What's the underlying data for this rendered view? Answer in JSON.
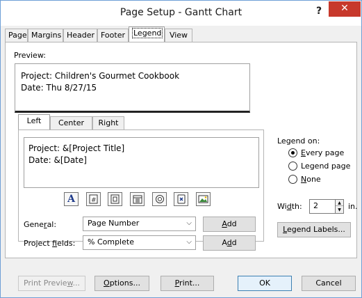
{
  "window": {
    "title": "Page Setup - Gantt Chart",
    "help": "?",
    "close": "✕"
  },
  "tabs": [
    "Page",
    "Margins",
    "Header",
    "Footer",
    "Legend",
    "View"
  ],
  "active_tab": "Legend",
  "preview": {
    "label": "Preview:",
    "lines": [
      "Project: Children's Gourmet Cookbook",
      "Date: Thu 8/27/15"
    ]
  },
  "alignment_tabs": [
    "Left",
    "Center",
    "Right"
  ],
  "active_alignment_tab": "Left",
  "legend_text": {
    "lines": [
      "Project: &[Project Title]",
      "Date: &[Date]"
    ]
  },
  "format_buttons": [
    {
      "name": "format-text-icon",
      "tooltip": "Format Text"
    },
    {
      "name": "insert-page-number-icon",
      "tooltip": "Insert Page Number"
    },
    {
      "name": "insert-total-pages-icon",
      "tooltip": "Insert Total Page Count"
    },
    {
      "name": "insert-date-icon",
      "tooltip": "Insert Current Date"
    },
    {
      "name": "insert-time-icon",
      "tooltip": "Insert Current Time"
    },
    {
      "name": "insert-file-name-icon",
      "tooltip": "Insert File Name"
    },
    {
      "name": "insert-picture-icon",
      "tooltip": "Insert Picture"
    }
  ],
  "general": {
    "label_pre": "Gene",
    "label_acc": "r",
    "label_post": "al:",
    "value": "Page Number",
    "add": "Add",
    "add_acc": "A",
    "add_rest": "dd"
  },
  "project_fields": {
    "label_pre": "Project ",
    "label_acc": "f",
    "label_post": "ields:",
    "value": "% Complete",
    "add_pre": "A",
    "add_acc": "d",
    "add_post": "d"
  },
  "legend_on": {
    "label": "Legend on:",
    "options": [
      {
        "pre": "",
        "acc": "E",
        "post": "very page",
        "checked": true
      },
      {
        "pre": "",
        "acc": "",
        "post": "Legend page",
        "checked": false
      },
      {
        "pre": "",
        "acc": "N",
        "post": "one",
        "checked": false
      }
    ]
  },
  "width": {
    "label_pre": "Wi",
    "label_acc": "d",
    "label_post": "th:",
    "value": "2",
    "unit": "in."
  },
  "legend_labels_button": {
    "pre": "",
    "acc": "L",
    "post": "egend Labels..."
  },
  "footer_buttons": {
    "print_preview": {
      "pre": "Print Previe",
      "acc": "w",
      "post": "..."
    },
    "options": {
      "pre": "",
      "acc": "O",
      "post": "ptions..."
    },
    "print": {
      "pre": "",
      "acc": "P",
      "post": "rint..."
    },
    "ok": "OK",
    "cancel": "Cancel"
  },
  "colors": {
    "close_button": "#c7392c",
    "window_border": "#6e9fd6",
    "default_button_border": "#3c7fb1"
  }
}
